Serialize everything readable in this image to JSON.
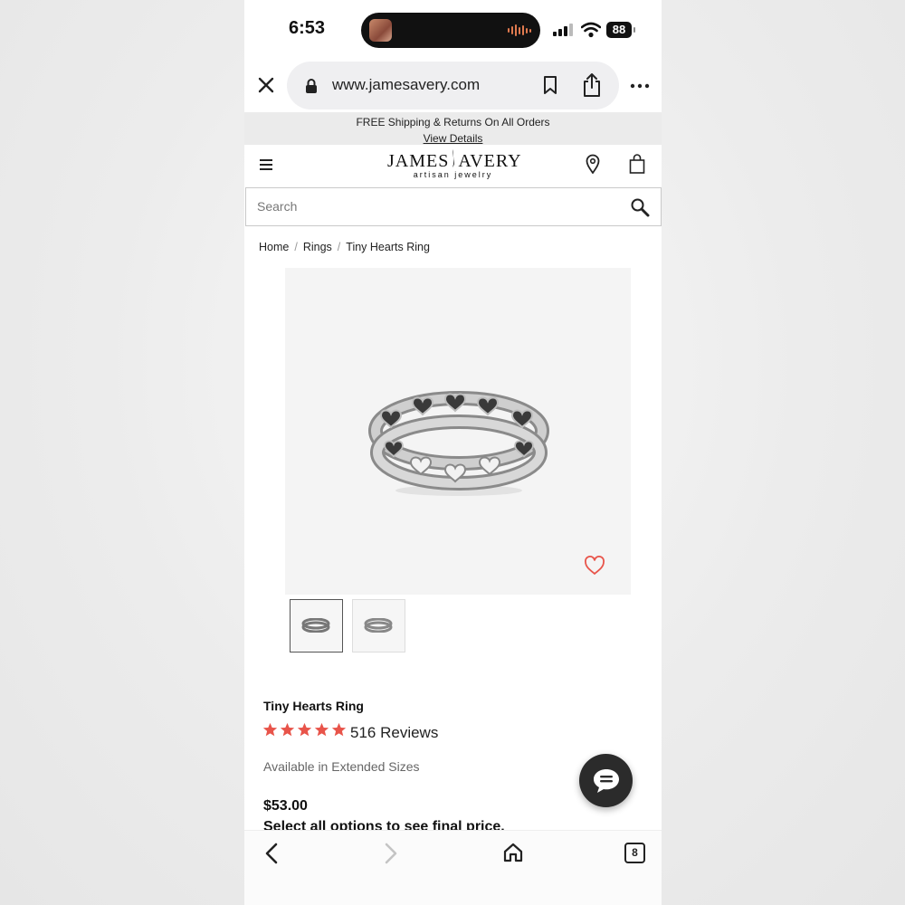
{
  "status_bar": {
    "time": "6:53",
    "battery": "88"
  },
  "browser": {
    "url": "www.jamesavery.com",
    "icons": [
      "close-icon",
      "lock-icon",
      "bookmark-icon",
      "share-icon",
      "more-icon"
    ]
  },
  "promo": {
    "text": "FREE Shipping & Returns On All Orders",
    "link": "View Details"
  },
  "header": {
    "logo_main_left": "JAMES",
    "logo_main_right": "AVERY",
    "logo_sub": "artisan jewelry",
    "icons": [
      "menu-icon",
      "store-locator-icon",
      "bag-icon"
    ]
  },
  "search": {
    "placeholder": "Search"
  },
  "breadcrumb": [
    "Home",
    "Rings",
    "Tiny Hearts Ring"
  ],
  "product": {
    "title": "Tiny Hearts Ring",
    "rating": 5,
    "reviews": "516 Reviews",
    "availability": "Available in Extended Sizes",
    "price": "$53.00",
    "options_note": "Select all options to see final price."
  },
  "toolbar": {
    "tabs_count": "8"
  },
  "colors": {
    "accent_star": "#e8544a",
    "heart_outline": "#e8544a",
    "chat_button": "#2b2b2b"
  }
}
